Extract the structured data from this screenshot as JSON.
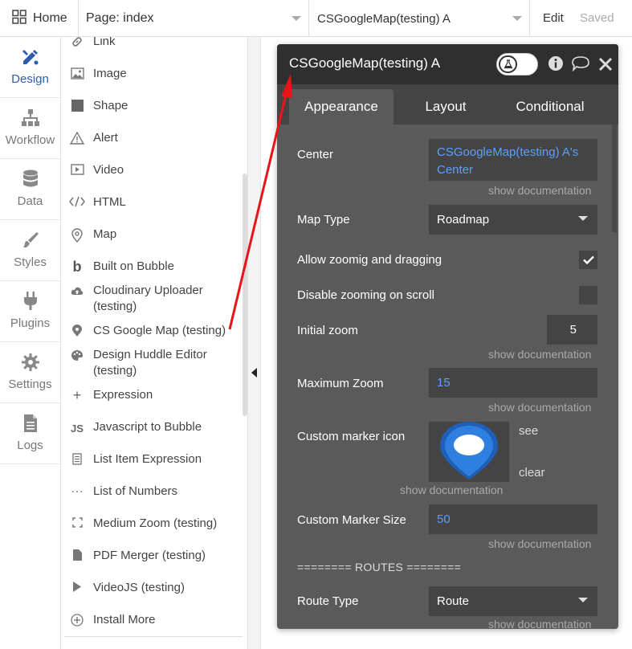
{
  "topbar": {
    "home_label": "Home",
    "page_label": "Page: index",
    "element_label": "CSGoogleMap(testing) A",
    "edit_label": "Edit",
    "saved_label": "Saved"
  },
  "leftnav": [
    {
      "label": "Design",
      "icon": "design-icon"
    },
    {
      "label": "Workflow",
      "icon": "workflow-icon"
    },
    {
      "label": "Data",
      "icon": "data-icon"
    },
    {
      "label": "Styles",
      "icon": "styles-icon"
    },
    {
      "label": "Plugins",
      "icon": "plugins-icon"
    },
    {
      "label": "Settings",
      "icon": "settings-icon"
    },
    {
      "label": "Logs",
      "icon": "logs-icon"
    }
  ],
  "palette": [
    {
      "label": "Link",
      "icon": "link-icon"
    },
    {
      "label": "Image",
      "icon": "image-icon"
    },
    {
      "label": "Shape",
      "icon": "shape-icon"
    },
    {
      "label": "Alert",
      "icon": "alert-icon"
    },
    {
      "label": "Video",
      "icon": "video-icon"
    },
    {
      "label": "HTML",
      "icon": "code-icon"
    },
    {
      "label": "Map",
      "icon": "map-pin-icon"
    },
    {
      "label": "Built on Bubble",
      "icon": "bubble-b-icon"
    },
    {
      "label": "Cloudinary Uploader (testing)",
      "icon": "cloud-upload-icon"
    },
    {
      "label": "CS Google Map (testing)",
      "icon": "location-pin-icon"
    },
    {
      "label": "Design Huddle Editor (testing)",
      "icon": "palette-icon"
    },
    {
      "label": "Expression",
      "icon": "plus-icon"
    },
    {
      "label": "Javascript to Bubble",
      "icon": "js-icon"
    },
    {
      "label": "List Item Expression",
      "icon": "list-doc-icon"
    },
    {
      "label": "List of Numbers",
      "icon": "ellipsis-icon"
    },
    {
      "label": "Medium Zoom (testing)",
      "icon": "expand-icon"
    },
    {
      "label": "PDF Merger (testing)",
      "icon": "file-icon"
    },
    {
      "label": "VideoJS (testing)",
      "icon": "play-icon"
    },
    {
      "label": "Install More",
      "icon": "plus-circle-icon"
    }
  ],
  "panel": {
    "title": "CSGoogleMap(testing) A",
    "tabs": [
      "Appearance",
      "Layout",
      "Conditional"
    ],
    "active_tab": "Appearance",
    "center_label": "Center",
    "center_value": "CSGoogleMap(testing) A's Center",
    "show_doc": "show documentation",
    "map_type_label": "Map Type",
    "map_type_value": "Roadmap",
    "allow_zoom_label": "Allow zoomig and dragging",
    "allow_zoom_checked": true,
    "disable_scroll_label": "Disable zooming on scroll",
    "disable_scroll_checked": false,
    "initial_zoom_label": "Initial zoom",
    "initial_zoom_value": "5",
    "max_zoom_label": "Maximum Zoom",
    "max_zoom_value": "15",
    "marker_icon_label": "Custom marker icon",
    "marker_see": "see",
    "marker_clear": "clear",
    "marker_size_label": "Custom Marker Size",
    "marker_size_value": "50",
    "routes_divider": "======== ROUTES ========",
    "route_type_label": "Route Type",
    "route_type_value": "Route"
  },
  "colors": {
    "accent": "#2a5db0",
    "panel_bg": "#5a5a5a",
    "field_bg": "#444444",
    "link_blue": "#5aa0ff",
    "annotation_red": "#e8141a"
  }
}
